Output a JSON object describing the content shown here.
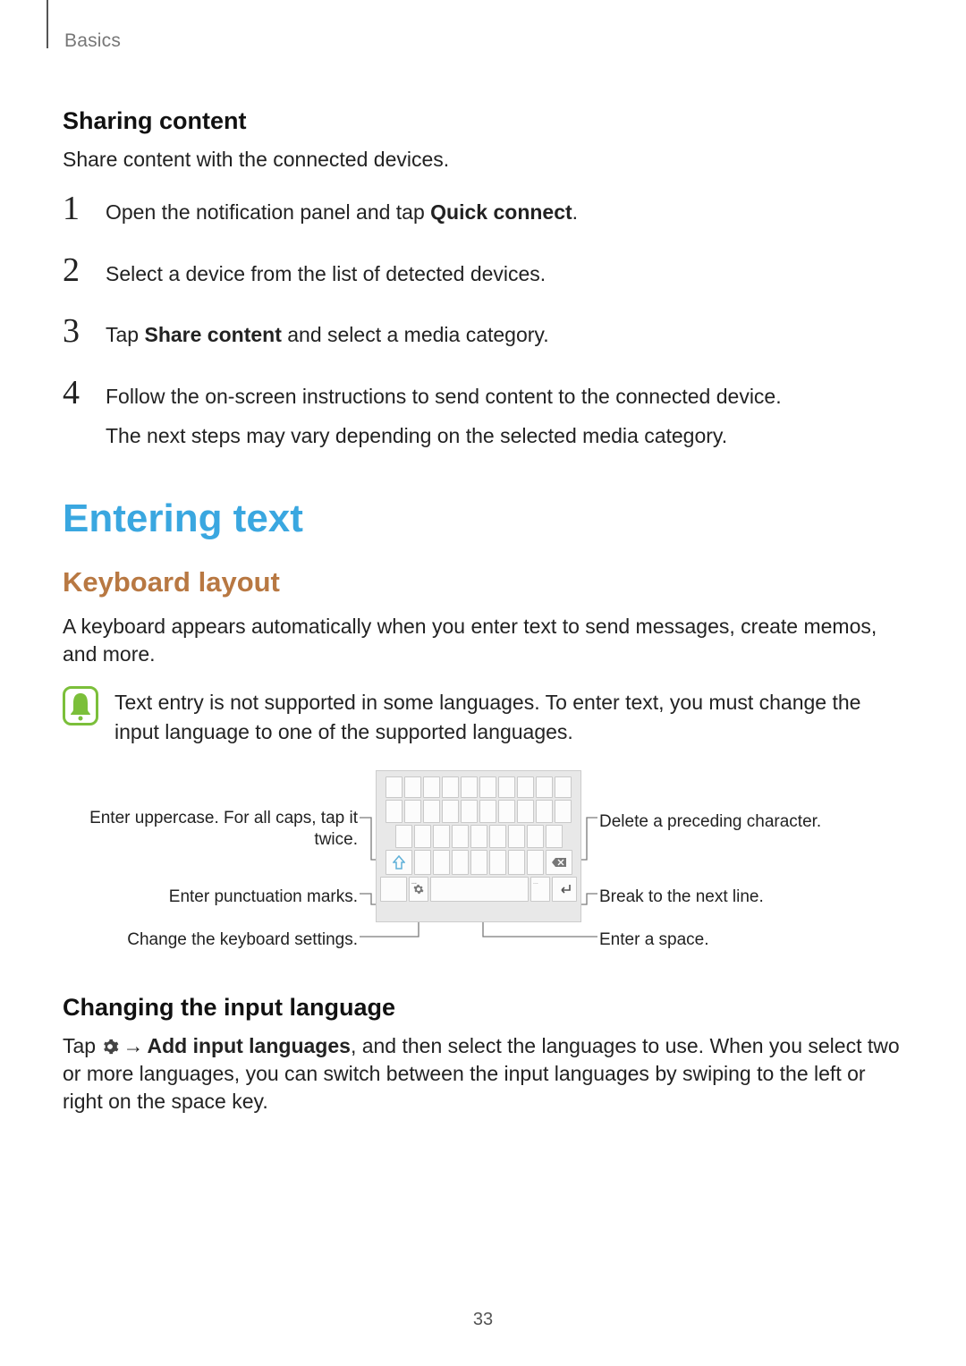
{
  "breadcrumb": "Basics",
  "page_number": "33",
  "sharing": {
    "heading": "Sharing content",
    "intro": "Share content with the connected devices.",
    "steps": {
      "s1_pre": "Open the notification panel and tap ",
      "s1_bold": "Quick connect",
      "s1_post": ".",
      "s2": "Select a device from the list of detected devices.",
      "s3_pre": "Tap ",
      "s3_bold": "Share content",
      "s3_post": " and select a media category.",
      "s4_line1": "Follow the on-screen instructions to send content to the connected device.",
      "s4_line2": "The next steps may vary depending on the selected media category."
    },
    "nums": {
      "n1": "1",
      "n2": "2",
      "n3": "3",
      "n4": "4"
    }
  },
  "entering": {
    "h1": "Entering text",
    "h2": "Keyboard layout",
    "para": "A keyboard appears automatically when you enter text to send messages, create memos, and more.",
    "note": "Text entry is not supported in some languages. To enter text, you must change the input language to one of the supported languages.",
    "callouts": {
      "uppercase": "Enter uppercase. For all caps, tap it twice.",
      "punct": "Enter punctuation marks.",
      "settings": "Change the keyboard settings.",
      "delete": "Delete a preceding character.",
      "linebreak": "Break to the next line.",
      "space": "Enter a space."
    }
  },
  "changing": {
    "heading": "Changing the input language",
    "pre": "Tap ",
    "arrow": "→",
    "bold": "Add input languages",
    "post": ", and then select the languages to use. When you select two or more languages, you can switch between the input languages by swiping to the left or right on the space key."
  },
  "icons": {
    "note": "note-bell-icon",
    "shift": "shift-arrow-icon",
    "backspace": "backspace-icon",
    "enter": "enter-icon",
    "gear": "gear-icon",
    "gear_dots": "..."
  }
}
